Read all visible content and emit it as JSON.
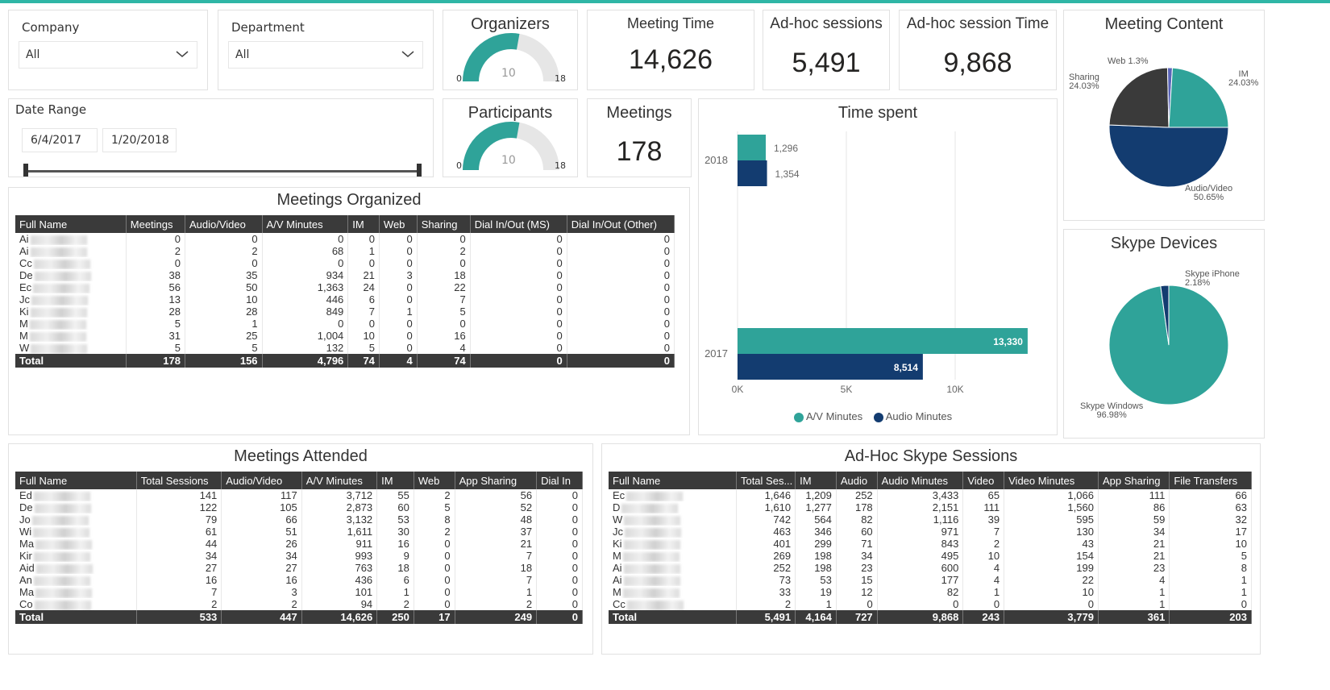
{
  "colors": {
    "teal": "#2fa399",
    "navy": "#133c70",
    "dark": "#3a3a3a",
    "accent_bar": "#2fb6a6"
  },
  "filters": {
    "company": {
      "label": "Company",
      "value": "All"
    },
    "department": {
      "label": "Department",
      "value": "All"
    },
    "date_range": {
      "label": "Date Range",
      "start": "6/4/2017",
      "end": "1/20/2018"
    }
  },
  "kpis": {
    "organizers": {
      "title": "Organizers",
      "value": 10,
      "value_label": "10",
      "min": "0",
      "max": "18"
    },
    "participants": {
      "title": "Participants",
      "value": 10,
      "value_label": "10",
      "min": "0",
      "max": "18"
    },
    "meeting_time": {
      "title": "Meeting Time",
      "value": "14,626"
    },
    "adhoc_sessions": {
      "title": "Ad-hoc sessions",
      "value": "5,491"
    },
    "adhoc_session_time": {
      "title": "Ad-hoc session Time",
      "value": "9,868"
    },
    "meetings": {
      "title": "Meetings",
      "value": "178"
    }
  },
  "meetings_organized": {
    "title": "Meetings Organized",
    "columns": [
      "Full Name",
      "Meetings",
      "Audio/Video",
      "A/V Minutes",
      "IM",
      "Web",
      "Sharing",
      "Dial In/Out (MS)",
      "Dial In/Out (Other)"
    ],
    "rows": [
      [
        "Ai",
        "0",
        "0",
        "0",
        "0",
        "0",
        "0",
        "0",
        "0"
      ],
      [
        "Ai",
        "2",
        "2",
        "68",
        "1",
        "0",
        "2",
        "0",
        "0"
      ],
      [
        "Cc",
        "0",
        "0",
        "0",
        "0",
        "0",
        "0",
        "0",
        "0"
      ],
      [
        "De",
        "38",
        "35",
        "934",
        "21",
        "3",
        "18",
        "0",
        "0"
      ],
      [
        "Ec",
        "56",
        "50",
        "1,363",
        "24",
        "0",
        "22",
        "0",
        "0"
      ],
      [
        "Jc",
        "13",
        "10",
        "446",
        "6",
        "0",
        "7",
        "0",
        "0"
      ],
      [
        "Ki",
        "28",
        "28",
        "849",
        "7",
        "1",
        "5",
        "0",
        "0"
      ],
      [
        "M",
        "5",
        "1",
        "0",
        "0",
        "0",
        "0",
        "0",
        "0"
      ],
      [
        "M",
        "31",
        "25",
        "1,004",
        "10",
        "0",
        "16",
        "0",
        "0"
      ],
      [
        "W",
        "5",
        "5",
        "132",
        "5",
        "0",
        "4",
        "0",
        "0"
      ]
    ],
    "total": [
      "Total",
      "178",
      "156",
      "4,796",
      "74",
      "4",
      "74",
      "0",
      "0"
    ]
  },
  "meetings_attended": {
    "title": "Meetings Attended",
    "columns": [
      "Full Name",
      "Total Sessions",
      "Audio/Video",
      "A/V Minutes",
      "IM",
      "Web",
      "App Sharing",
      "Dial In"
    ],
    "rows": [
      [
        "Ed",
        "141",
        "117",
        "3,712",
        "55",
        "2",
        "56",
        "0"
      ],
      [
        "De",
        "122",
        "105",
        "2,873",
        "60",
        "5",
        "52",
        "0"
      ],
      [
        "Jo",
        "79",
        "66",
        "3,132",
        "53",
        "8",
        "48",
        "0"
      ],
      [
        "Wi",
        "61",
        "51",
        "1,611",
        "30",
        "2",
        "37",
        "0"
      ],
      [
        "Ma",
        "44",
        "26",
        "911",
        "16",
        "0",
        "21",
        "0"
      ],
      [
        "Kir",
        "34",
        "34",
        "993",
        "9",
        "0",
        "7",
        "0"
      ],
      [
        "Aid",
        "27",
        "27",
        "763",
        "18",
        "0",
        "18",
        "0"
      ],
      [
        "An",
        "16",
        "16",
        "436",
        "6",
        "0",
        "7",
        "0"
      ],
      [
        "Ma",
        "7",
        "3",
        "101",
        "1",
        "0",
        "1",
        "0"
      ],
      [
        "Co",
        "2",
        "2",
        "94",
        "2",
        "0",
        "2",
        "0"
      ]
    ],
    "total": [
      "Total",
      "533",
      "447",
      "14,626",
      "250",
      "17",
      "249",
      "0"
    ]
  },
  "adhoc_sessions": {
    "title": "Ad-Hoc Skype Sessions",
    "columns": [
      "Full Name",
      "Total Ses...",
      "IM",
      "Audio",
      "Audio Minutes",
      "Video",
      "Video Minutes",
      "App Sharing",
      "File Transfers"
    ],
    "rows": [
      [
        "Ec",
        "1,646",
        "1,209",
        "252",
        "3,433",
        "65",
        "1,066",
        "111",
        "66"
      ],
      [
        "D",
        "1,610",
        "1,277",
        "178",
        "2,151",
        "111",
        "1,560",
        "86",
        "63"
      ],
      [
        "W",
        "742",
        "564",
        "82",
        "1,116",
        "39",
        "595",
        "59",
        "32"
      ],
      [
        "Jc",
        "463",
        "346",
        "60",
        "971",
        "7",
        "130",
        "34",
        "17"
      ],
      [
        "Ki",
        "401",
        "299",
        "71",
        "843",
        "2",
        "43",
        "21",
        "10"
      ],
      [
        "M",
        "269",
        "198",
        "34",
        "495",
        "10",
        "154",
        "21",
        "5"
      ],
      [
        "Ai",
        "252",
        "198",
        "23",
        "600",
        "4",
        "199",
        "23",
        "8"
      ],
      [
        "Ai",
        "73",
        "53",
        "15",
        "177",
        "4",
        "22",
        "4",
        "1"
      ],
      [
        "M",
        "33",
        "19",
        "12",
        "82",
        "1",
        "10",
        "1",
        "1"
      ],
      [
        "Cc",
        "2",
        "1",
        "0",
        "0",
        "0",
        "0",
        "1",
        "0"
      ]
    ],
    "total": [
      "Total",
      "5,491",
      "4,164",
      "727",
      "9,868",
      "243",
      "3,779",
      "361",
      "203"
    ]
  },
  "chart_data": [
    {
      "type": "bar",
      "title": "Time spent",
      "orientation": "horizontal",
      "categories": [
        "2018",
        "2017"
      ],
      "series": [
        {
          "name": "A/V Minutes",
          "values": [
            1296,
            13330
          ],
          "labels": [
            "1,296",
            "13,330"
          ],
          "color": "#2fa399"
        },
        {
          "name": "Audio Minutes",
          "values": [
            1354,
            8514
          ],
          "labels": [
            "1,354",
            "8,514"
          ],
          "color": "#133c70"
        }
      ],
      "x_ticks": [
        "0K",
        "5K",
        "10K"
      ],
      "xlim": [
        0,
        15000
      ],
      "grid": true,
      "legend": "bottom"
    },
    {
      "type": "pie",
      "title": "Meeting Content",
      "slices": [
        {
          "label": "Audio/Video",
          "pct": "50.65%",
          "value": 50.65,
          "color": "#133c70"
        },
        {
          "label": "Sharing",
          "pct": "24.03%",
          "value": 24.03,
          "color": "#3a3a3a"
        },
        {
          "label": "Web 1.3%",
          "pct": "",
          "value": 1.3,
          "color": "#5a64b8"
        },
        {
          "label": "IM",
          "pct": "24.03%",
          "value": 24.03,
          "color": "#2fa399"
        }
      ]
    },
    {
      "type": "pie",
      "title": "Skype Devices",
      "slices": [
        {
          "label": "Skype Windows",
          "pct": "96.98%",
          "value": 96.98,
          "color": "#2fa399"
        },
        {
          "label": "Skype iPhone",
          "pct": "2.18%",
          "value": 2.18,
          "color": "#133c70"
        }
      ]
    }
  ]
}
